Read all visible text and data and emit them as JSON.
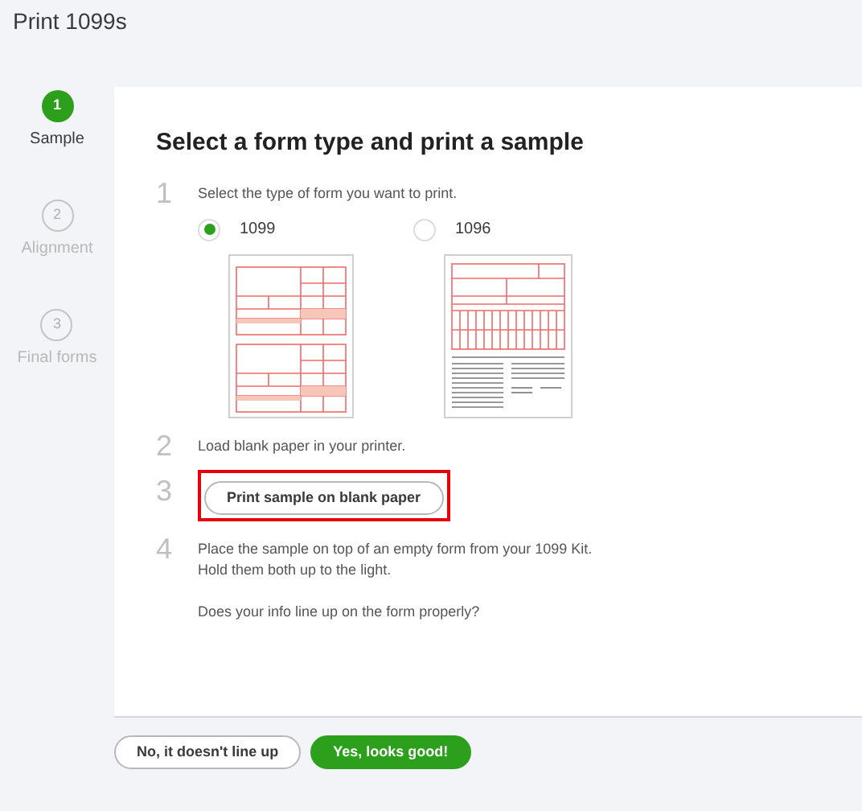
{
  "window": {
    "title": "Print 1099s"
  },
  "steps": [
    {
      "number": "1",
      "label": "Sample",
      "selected": true
    },
    {
      "number": "2",
      "label": "Alignment",
      "selected": false
    },
    {
      "number": "3",
      "label": "Final forms",
      "selected": false
    }
  ],
  "card": {
    "heading": "Select a form type and print a sample",
    "instructions": [
      {
        "number": "1",
        "kind": "choice",
        "text": "Select the type of form you want to print.",
        "options": [
          {
            "label": "1099",
            "selected": true
          },
          {
            "label": "1096",
            "selected": false
          }
        ]
      },
      {
        "number": "2",
        "kind": "text",
        "text": "Load blank paper in your printer."
      },
      {
        "number": "3",
        "kind": "button",
        "button": "Print sample on blank paper",
        "highlighted": true
      },
      {
        "number": "4",
        "kind": "paragraphs",
        "paragraphs": [
          "Place the sample on top of an empty form from your 1099 Kit.\nHold them both up to the light.",
          "Does your info line up on the form properly?"
        ]
      }
    ]
  },
  "buttons": [
    {
      "label": "No, it doesn't line up",
      "kind": "secondary"
    },
    {
      "label": "Yes, looks good!",
      "kind": "primary"
    }
  ]
}
